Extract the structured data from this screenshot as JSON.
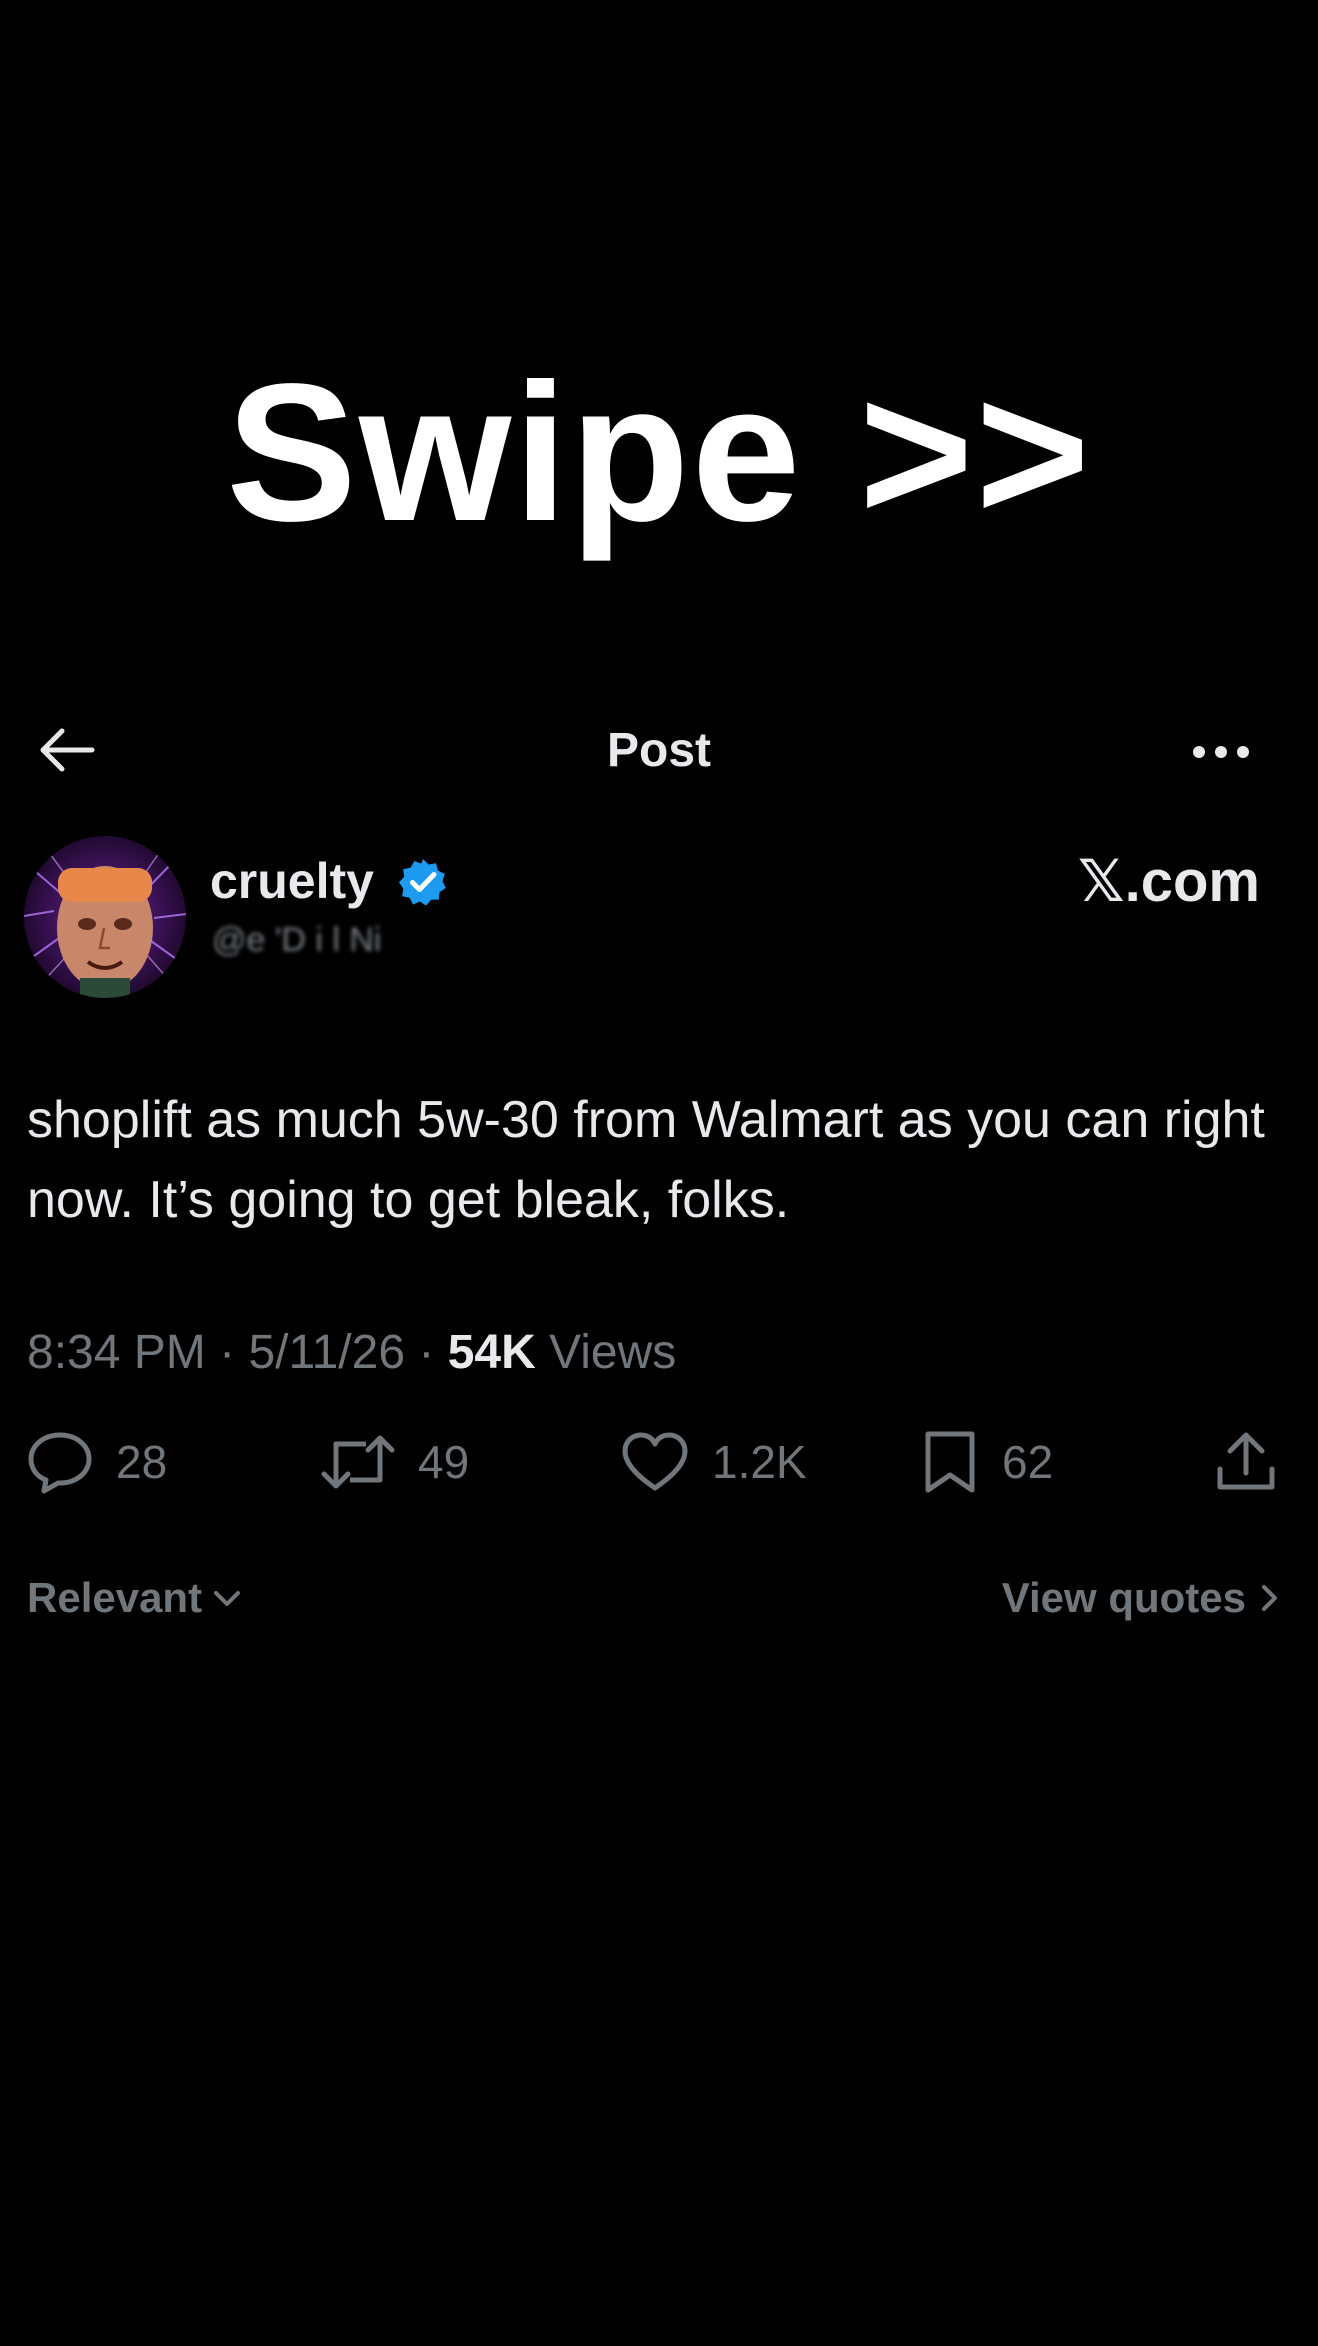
{
  "banner": {
    "text": "Swipe >>"
  },
  "nav": {
    "title": "Post",
    "back_icon": "arrow-left-icon",
    "more_icon": "more-horizontal-icon"
  },
  "author": {
    "display_name": "cruelty",
    "verified_icon": "verified-badge-icon",
    "handle": "@e  'D i l Ni",
    "source": "𝕏.com"
  },
  "post": {
    "text": "shoplift as much 5w-30 from Walmart as you can right now. It’s going to get bleak, folks.",
    "time": "8:34 PM",
    "date": "5/11/26",
    "views_count": "54K",
    "views_label": "Views",
    "separator": "·"
  },
  "actions": {
    "replies": "28",
    "reposts": "49",
    "likes": "1.2K",
    "bookmarks": "62"
  },
  "footer": {
    "filter_label": "Relevant",
    "view_quotes_label": "View quotes"
  },
  "colors": {
    "background": "#000000",
    "text_primary": "#e7e9ea",
    "text_secondary": "#71767b",
    "verified_blue": "#1d9bf0"
  }
}
